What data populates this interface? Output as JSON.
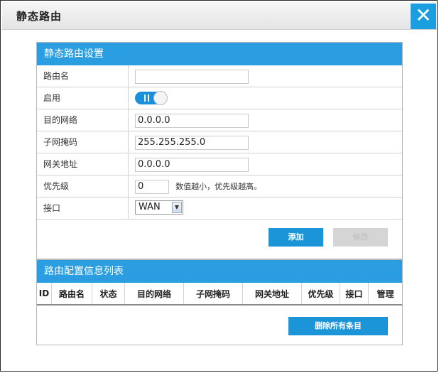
{
  "window": {
    "title": "静态路由",
    "close_symbol": "✕"
  },
  "settings": {
    "header": "静态路由设置",
    "route_name": {
      "label": "路由名",
      "value": ""
    },
    "enable": {
      "label": "启用",
      "on": true
    },
    "dest_network": {
      "label": "目的网络",
      "value": "0.0.0.0"
    },
    "subnet_mask": {
      "label": "子网掩码",
      "value": "255.255.255.0"
    },
    "gateway": {
      "label": "网关地址",
      "value": "0.0.0.0"
    },
    "priority": {
      "label": "优先级",
      "value": "0",
      "hint": "数值越小，优先级越高。"
    },
    "interface": {
      "label": "接口",
      "value": "WAN",
      "options": [
        "WAN"
      ]
    },
    "add_label": "添加",
    "modify_label": "修改"
  },
  "list": {
    "header": "路由配置信息列表",
    "columns": [
      "ID",
      "路由名",
      "状态",
      "目的网络",
      "子网掩码",
      "网关地址",
      "优先级",
      "接口",
      "管理"
    ],
    "rows": [],
    "delete_all_label": "删除所有条目"
  },
  "colors": {
    "accent": "#2b9ee2",
    "button": "#1b94d8",
    "disabled": "#d5d5d5"
  }
}
